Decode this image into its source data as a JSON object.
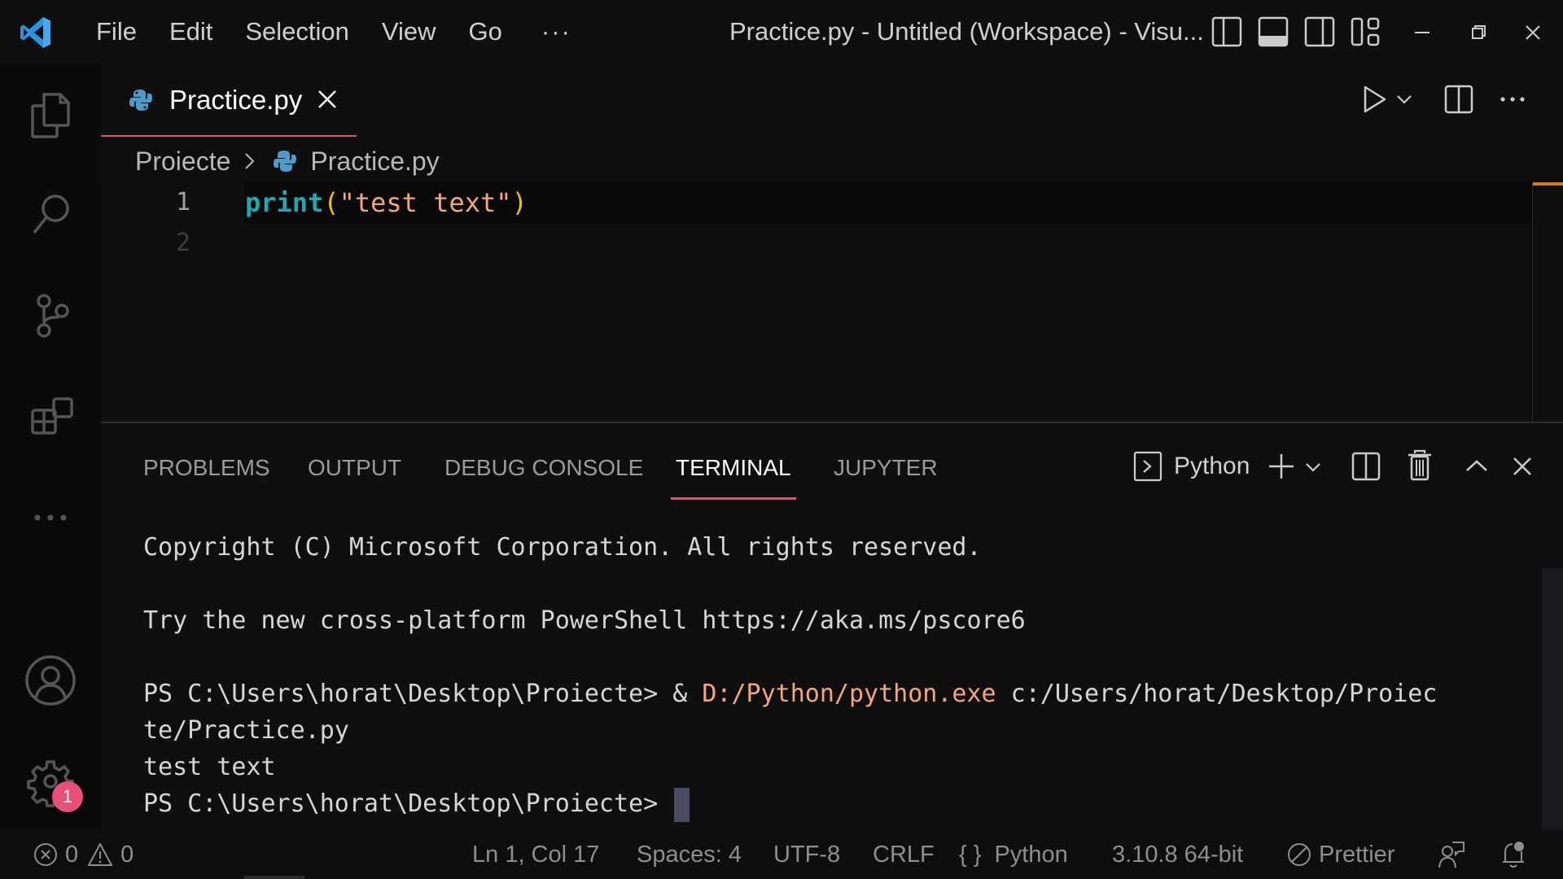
{
  "titlebar": {
    "menu": [
      "File",
      "Edit",
      "Selection",
      "View",
      "Go"
    ],
    "more": "···",
    "window_title": "Practice.py - Untitled (Workspace) - Visu...",
    "layout_icons": [
      "toggle-primary-sidebar-icon",
      "toggle-panel-icon",
      "toggle-secondary-sidebar-icon",
      "customize-layout-icon"
    ],
    "window_controls": [
      "minimize-icon",
      "restore-icon",
      "close-icon"
    ]
  },
  "activitybar": {
    "items": [
      "explorer",
      "search",
      "source-control",
      "extensions",
      "more"
    ],
    "bottom": [
      "accounts",
      "manage"
    ],
    "manage_badge": "1"
  },
  "editor": {
    "tab": {
      "label": "Practice.py",
      "icon": "python-icon"
    },
    "breadcrumb": {
      "folder": "Proiecte",
      "file": "Practice.py"
    },
    "lines": [
      {
        "num": "1",
        "fn": "print",
        "open": "(",
        "str": "\"test text\"",
        "close": ")"
      },
      {
        "num": "2"
      }
    ],
    "actions": [
      "run-python-file",
      "run-options",
      "split-editor",
      "more-actions"
    ]
  },
  "panel": {
    "tabs": [
      "PROBLEMS",
      "OUTPUT",
      "DEBUG CONSOLE",
      "TERMINAL",
      "JUPYTER"
    ],
    "active_tab": "TERMINAL",
    "terminal_profile": "Python",
    "terminal": {
      "copyright": "Copyright (C) Microsoft Corporation. All rights reserved.",
      "try_line": "Try the new cross-platform PowerShell https://aka.ms/pscore6",
      "cmd_prompt": "PS C:\\Users\\horat\\Desktop\\Proiecte> & ",
      "cmd_exe": "D:/Python/python.exe",
      "cmd_arg": " c:/Users/horat/Desktop/Proiec",
      "cmd_wrap": "te/Practice.py",
      "output": "test text",
      "prompt": "PS C:\\Users\\horat\\Desktop\\Proiecte> "
    }
  },
  "statusbar": {
    "errors": "0",
    "warnings": "0",
    "position": "Ln 1, Col 17",
    "spaces": "Spaces: 4",
    "encoding": "UTF-8",
    "eol": "CRLF",
    "language": "Python",
    "interpreter": "3.10.8 64-bit",
    "formatter": "Prettier"
  },
  "colors": {
    "accent": "#e8506b",
    "badge": "#e8507a",
    "function": "#22a7b5",
    "string": "#f5a77b",
    "paren": "#f0c000"
  }
}
